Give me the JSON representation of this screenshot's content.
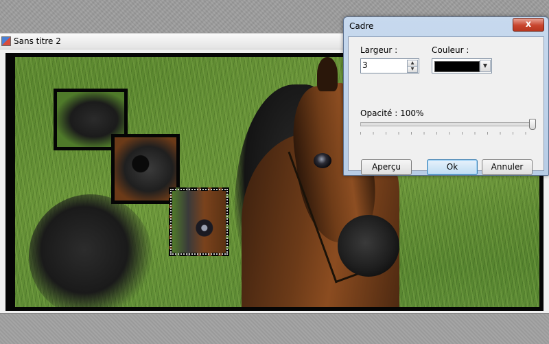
{
  "document": {
    "title": "Sans titre 2"
  },
  "dialog": {
    "title": "Cadre",
    "close_symbol": "x",
    "width_label": "Largeur :",
    "width_value": "3",
    "color_label": "Couleur :",
    "color_value": "#000000",
    "opacity_label": "Opacité : 100%",
    "opacity_fraction": 1.0,
    "preview_label": "Aperçu",
    "ok_label": "Ok",
    "cancel_label": "Annuler"
  },
  "icons": {
    "app_icon": "document-icon",
    "spin_up": "spin-up-icon",
    "spin_down": "spin-down-icon",
    "dropdown": "chevron-down-icon"
  }
}
